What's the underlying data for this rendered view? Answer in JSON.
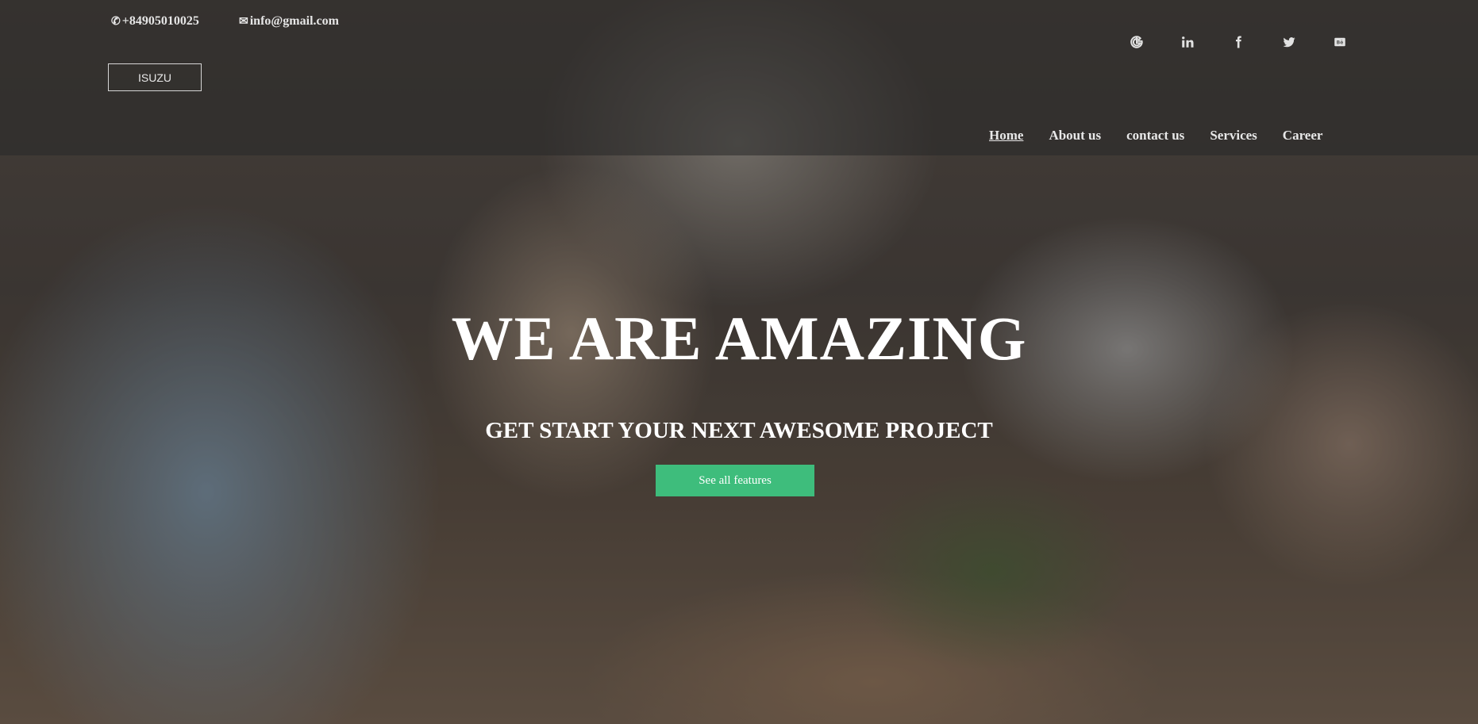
{
  "topbar": {
    "phone": "+84905010025",
    "email": "info@gmail.com",
    "brand": "ISUZU"
  },
  "social": [
    {
      "name": "google-icon",
      "glyph": "G"
    },
    {
      "name": "linkedin-icon",
      "glyph": "in"
    },
    {
      "name": "facebook-icon",
      "glyph": "f"
    },
    {
      "name": "twitter-icon",
      "glyph": "twitter"
    },
    {
      "name": "behance-icon",
      "glyph": "Bē"
    }
  ],
  "nav": {
    "items": [
      {
        "label": "Home",
        "active": true
      },
      {
        "label": "About us"
      },
      {
        "label": "contact us"
      },
      {
        "label": "Services"
      },
      {
        "label": "Career"
      }
    ]
  },
  "hero": {
    "title": "WE ARE AMAZING",
    "subtitle": "GET START YOUR NEXT AWESOME PROJECT",
    "cta_label": "See all features"
  },
  "colors": {
    "accent": "#3ebd7c",
    "header_overlay": "rgba(40,40,40,0.55)"
  }
}
